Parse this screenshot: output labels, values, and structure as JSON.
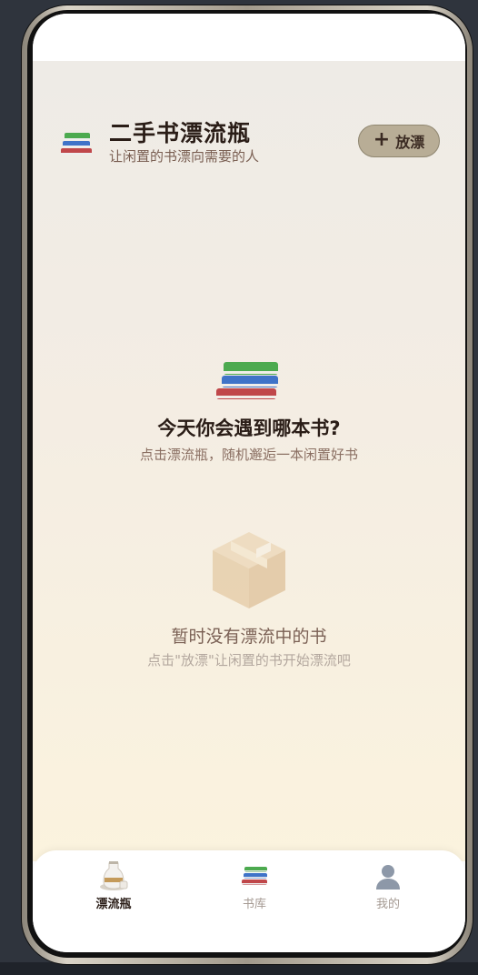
{
  "header": {
    "title": "二手书漂流瓶",
    "subtitle": "让闲置的书漂向需要的人",
    "icon": "books-icon",
    "release_button": {
      "icon": "plus-icon",
      "label": "放漂"
    }
  },
  "prompt": {
    "icon": "books-icon",
    "title": "今天你会遇到哪本书?",
    "subtitle": "点击漂流瓶，随机邂逅一本闲置好书"
  },
  "empty_state": {
    "icon": "package-box-icon",
    "title": "暂时没有漂流中的书",
    "subtitle": "点击\"放漂\"让闲置的书开始漂流吧"
  },
  "tabbar": {
    "tabs": [
      {
        "label": "漂流瓶",
        "icon": "sake-bottle-icon",
        "active": true
      },
      {
        "label": "书库",
        "icon": "books-icon",
        "active": false
      },
      {
        "label": "我的",
        "icon": "user-silhouette-icon",
        "active": false
      }
    ]
  },
  "colors": {
    "title_text": "#2a1d17",
    "release_button_bg": "#b8ad96",
    "background_top": "#eeebe6",
    "background_bottom": "#fbf3de"
  }
}
